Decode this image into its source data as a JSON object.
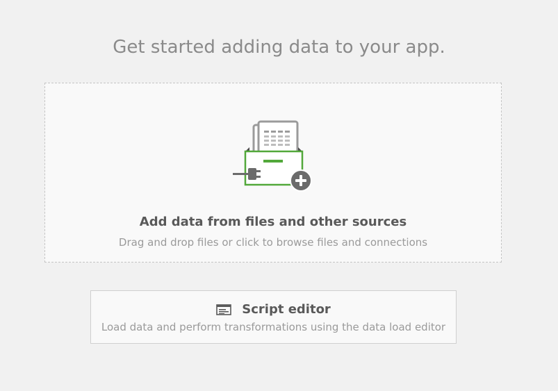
{
  "main": {
    "heading": "Get started adding data to your app."
  },
  "add_data": {
    "title": "Add data from files and other sources",
    "subtitle": "Drag and drop files or click to browse files and connections",
    "icon": "add-data-source-icon"
  },
  "script_editor": {
    "title": "Script editor",
    "subtitle": "Load data and perform transformations using the data load editor",
    "icon": "script-editor-icon"
  },
  "colors": {
    "background": "#f1f1f1",
    "card": "#f9f9f9",
    "accent_green": "#52a83a",
    "text_dark": "#595959",
    "text_muted": "#9a9a9a"
  }
}
